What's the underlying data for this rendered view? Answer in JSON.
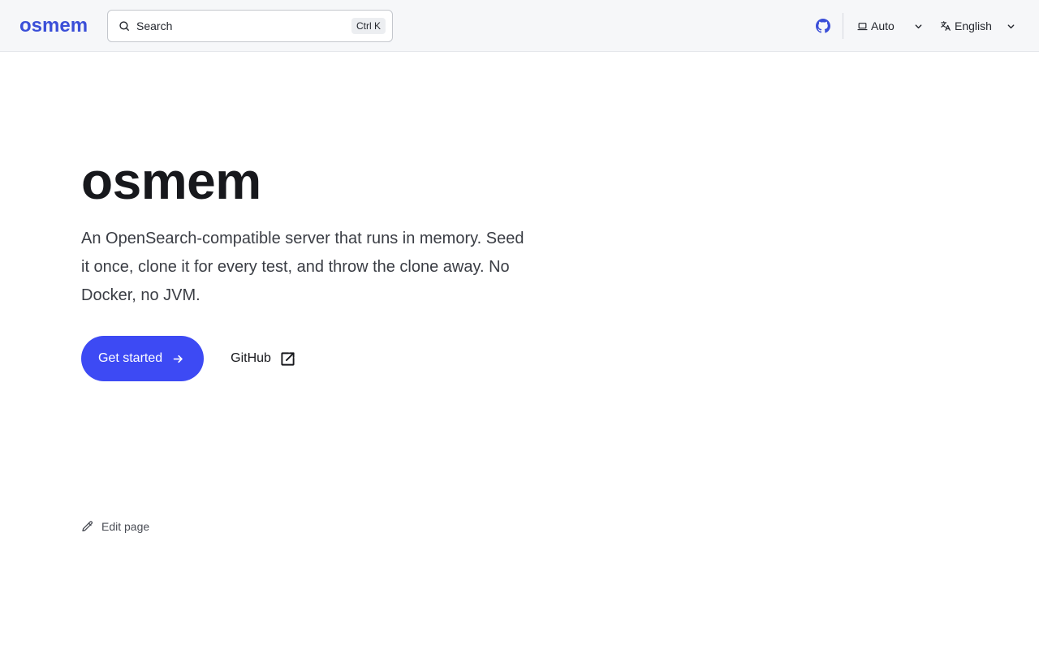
{
  "header": {
    "brand": "osmem",
    "search": {
      "label": "Search",
      "shortcut": "Ctrl K"
    },
    "github_icon": "github-icon",
    "theme": {
      "icon": "laptop-icon",
      "selected": "Auto"
    },
    "language": {
      "icon": "translate-icon",
      "selected": "English"
    }
  },
  "hero": {
    "title": "osmem",
    "tagline": "An OpenSearch-compatible server that runs in memory. Seed it once, clone it for every test, and throw the clone away. No Docker, no JVM.",
    "primary_action": {
      "label": "Get started",
      "icon": "arrow-right-icon"
    },
    "secondary_action": {
      "label": "GitHub",
      "icon": "external-link-icon"
    }
  },
  "footer": {
    "edit_page": {
      "label": "Edit page",
      "icon": "pencil-icon"
    }
  },
  "colors": {
    "accent": "#3d4af4",
    "brand": "#3b4fd8",
    "header_bg": "#f6f7f9"
  }
}
